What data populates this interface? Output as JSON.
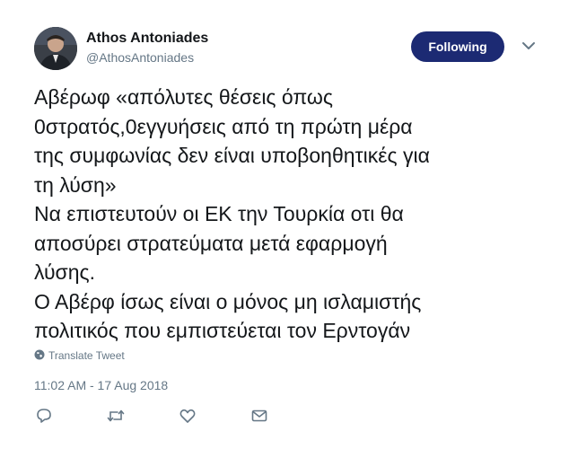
{
  "author": {
    "name": "Athos Antoniades",
    "handle": "@AthosAntoniades"
  },
  "follow_button": {
    "label": "Following",
    "color": "#1c2a73"
  },
  "tweet": {
    "lines": [
      "Αβέρωφ «απόλυτες θέσεις όπως",
      "0στρατός,0εγγυήσεις από τη πρώτη μέρα",
      "της συμφωνίας δεν είναι υποβοηθητικές για",
      "τη λύση»",
      "Να επιστευτούν οι ΕΚ την Τουρκία οτι θα",
      "αποσύρει στρατεύματα μετά εφαρμογή",
      "λύσης.",
      "Ο Αβέρφ ίσως είναι ο μόνος μη ισλαμιστής",
      "πολιτικός που εμπιστεύεται τον Ερντογάν"
    ],
    "translate_label": "Translate Tweet",
    "timestamp": "11:02 AM - 17 Aug 2018"
  },
  "actions": {
    "icons": [
      "reply-icon",
      "retweet-icon",
      "like-icon",
      "direct-message-icon"
    ]
  },
  "colors": {
    "text": "#14171a",
    "secondary": "#657786"
  }
}
